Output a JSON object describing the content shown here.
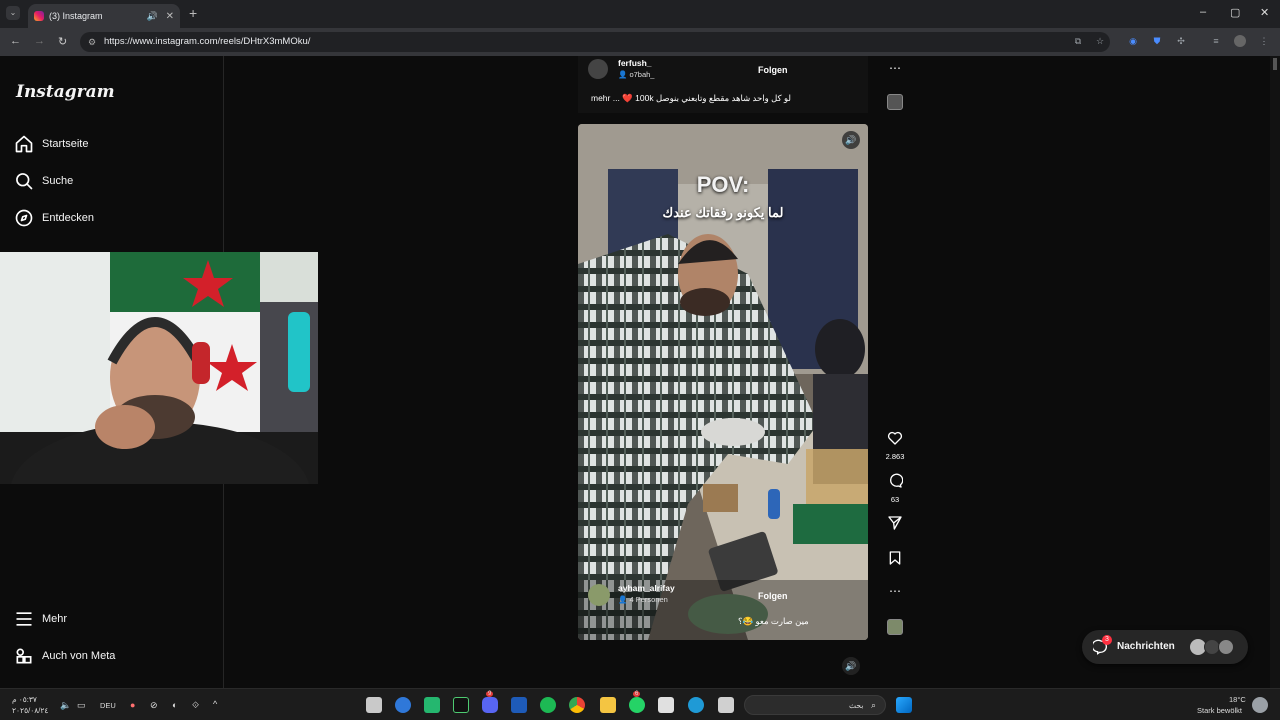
{
  "browser": {
    "tab_title": "(3) Instagram",
    "url": "https://www.instagram.com/reels/DHtrX3mMOku/",
    "new_tab_symbol": "+",
    "window_controls": [
      "–",
      "▢",
      "✕"
    ]
  },
  "sidebar": {
    "logo": "Instagram",
    "items": [
      {
        "label": "Startseite",
        "icon": "home-icon"
      },
      {
        "label": "Suche",
        "icon": "search-icon"
      },
      {
        "label": "Entdecken",
        "icon": "compass-icon"
      }
    ],
    "bottom_items": [
      {
        "label": "Mehr",
        "icon": "menu-icon"
      },
      {
        "label": "Auch von Meta",
        "icon": "meta-icon"
      }
    ]
  },
  "previous_reel": {
    "username": "ferfush_",
    "collab": "o7bah_",
    "follow": "Folgen",
    "caption": "لو كل واحد شاهد مقطع وتابعني بنوصل 100k ❤️ ...",
    "more": "mehr"
  },
  "current_reel": {
    "overlay_title": "POV:",
    "overlay_subtitle": "لما يكونو رفقاتك عندك",
    "username": "ayham_alrifay",
    "people": "4 Personen",
    "follow": "Folgen",
    "caption": "مين صارت معو 😂؟",
    "likes": "2.863",
    "comments": "63"
  },
  "messages": {
    "label": "Nachrichten",
    "badge": "3"
  },
  "taskbar": {
    "time": "٠٥:٣٧ م",
    "date": "٢٠٢٥/٠٨/٢٤",
    "lang": "DEU",
    "search_placeholder": "بحث",
    "weather_temp": "18°C",
    "weather_text": "Stark bewölkt",
    "discord_badge": "9",
    "whatsapp_badge": "6"
  },
  "colors": {
    "accent": "#0095f6",
    "badge": "#ff3040"
  }
}
